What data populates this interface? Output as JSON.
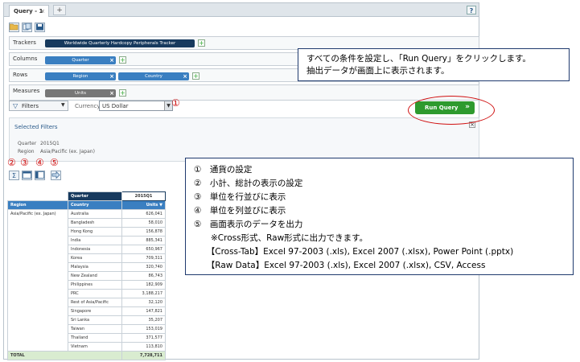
{
  "tabs": [
    {
      "label": "Query - 1",
      "close": "×"
    }
  ],
  "new_tab_label": "+",
  "help_label": "?",
  "toolbar": {
    "open_icon": "folder-open-icon",
    "save_as_icon": "copy-icon",
    "save_icon": "save-icon"
  },
  "rows": {
    "trackers": {
      "label": "Trackers",
      "pills": [
        {
          "text": "Worldwide Quarterly Hardcopy Peripherals Tracker"
        }
      ]
    },
    "columns": {
      "label": "Columns",
      "pills": [
        {
          "text": "Quarter",
          "close": "×"
        }
      ]
    },
    "rows": {
      "label": "Rows",
      "pills": [
        {
          "text": "Region",
          "close": "×"
        },
        {
          "text": "Country",
          "close": "×"
        }
      ]
    },
    "measures": {
      "label": "Measures",
      "pills": [
        {
          "text": "Units",
          "close": "×"
        }
      ]
    }
  },
  "add_label": "+",
  "filters": {
    "button_label": "Filters",
    "currency_label": "Currency",
    "currency_value": "US Dollar"
  },
  "run_query_label": "Run Query",
  "selected_filters": {
    "title": "Selected Filters",
    "close": "×",
    "items": [
      {
        "k": "Quarter",
        "v": "2015Q1"
      },
      {
        "k": "Region",
        "v": "Asia/Pacific (ex. Japan)"
      }
    ]
  },
  "annotations": {
    "n1": "①",
    "n2": "②",
    "n3": "③",
    "n4": "④",
    "n5": "⑤",
    "callout_top": [
      "すべての条件を設定し、「Run Query」をクリックします。",
      "抽出データが画面上に表示されます。"
    ],
    "callout_list": [
      "①　通貨の設定",
      "②　小計、総計の表示の設定",
      "③　単位を行並びに表示",
      "④　単位を列並びに表示",
      "⑤　画面表示のデータを出力",
      "　　※Cross形式、Raw形式に出力できます。",
      "　　【Cross-Tab】Excel 97-2003 (.xls), Excel 2007 (.xlsx), Power Point (.pptx)",
      "　　【Raw Data】Excel 97-2003 (.xls), Excel 2007 (.xlsx), CSV, Access"
    ]
  },
  "result_tools": {
    "sigma": "Σ"
  },
  "table": {
    "col_header": "Quarter",
    "col_value": "2015Q1",
    "headers": [
      "Region",
      "Country",
      "Units"
    ],
    "region": "Asia/Pacific (ex. Japan)",
    "rows": [
      {
        "country": "Australia",
        "units": "626,041"
      },
      {
        "country": "Bangladesh",
        "units": "58,010"
      },
      {
        "country": "Hong Kong",
        "units": "156,878"
      },
      {
        "country": "India",
        "units": "885,341"
      },
      {
        "country": "Indonesia",
        "units": "650,967"
      },
      {
        "country": "Korea",
        "units": "709,311"
      },
      {
        "country": "Malaysia",
        "units": "320,740"
      },
      {
        "country": "New Zealand",
        "units": "86,743"
      },
      {
        "country": "Philippines",
        "units": "182,909"
      },
      {
        "country": "PRC",
        "units": "3,188,217"
      },
      {
        "country": "Rest of Asia/Pacific",
        "units": "32,120"
      },
      {
        "country": "Singapore",
        "units": "147,821"
      },
      {
        "country": "Sri Lanka",
        "units": "35,207"
      },
      {
        "country": "Taiwan",
        "units": "153,019"
      },
      {
        "country": "Thailand",
        "units": "371,577"
      },
      {
        "country": "Vietnam",
        "units": "113,810"
      }
    ],
    "total_label": "TOTAL",
    "total_value": "7,728,711"
  },
  "colors": {
    "navy": "#173a5e",
    "blue": "#3a7fc1",
    "green": "#2e9a2e",
    "red": "#d01010"
  }
}
